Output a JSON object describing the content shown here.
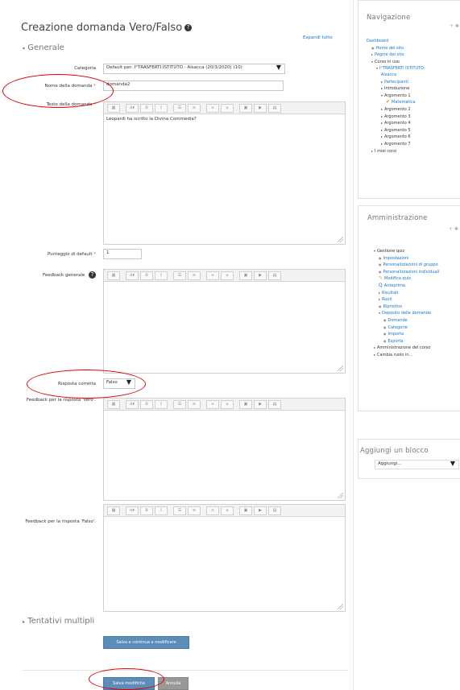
{
  "page_title": "Creazione domanda Vero/Falso",
  "expand_all": "Espandi tutto",
  "section_general": "Generale",
  "section_multiple": "Tentativi multipli",
  "category": {
    "label": "Categoria",
    "value": "Default per: I°TRASFERTI ISTITUTO - Alsacca (20/3/2020) (10)"
  },
  "question_name": {
    "label": "Nome della domanda",
    "value": "domanda2"
  },
  "question_text": {
    "label": "Testo della domanda",
    "value": "Leopardi ha scritto la Divina Commedia?"
  },
  "default_mark": {
    "label": "Punteggio di default",
    "value": "1"
  },
  "general_feedback": {
    "label": "Feedback generale"
  },
  "correct_answer": {
    "label": "Risposta corretta",
    "value": "Falso"
  },
  "feedback_true": {
    "label": "Feedback per la risposta 'Vero'."
  },
  "feedback_false": {
    "label": "Feedback per la risposta 'Falso'."
  },
  "buttons": {
    "save_continue": "Salva e continua a modificare",
    "save": "Salva modifiche",
    "cancel": "Annulla"
  },
  "toolbar_icons": [
    "table-icon",
    "font-size-icon",
    "bold-icon",
    "italic-icon",
    "unordered-list-icon",
    "ordered-list-icon",
    "link-icon",
    "unlink-icon",
    "image-icon",
    "media-icon",
    "file-icon"
  ],
  "navigation": {
    "title": "Navigazione",
    "items": [
      {
        "text": "Dashboard",
        "level": 0,
        "kind": "link"
      },
      {
        "text": "Home del sito",
        "level": 1,
        "kind": "dot"
      },
      {
        "text": "Pagine del sito",
        "level": 1,
        "kind": "tri"
      },
      {
        "text": "Corso in uso",
        "level": 1,
        "kind": "open",
        "plain": true
      },
      {
        "text": "I°TRASFERTI ISTITUTO-",
        "level": 2,
        "kind": "open"
      },
      {
        "text": "Alsacca",
        "level": 3,
        "kind": "none"
      },
      {
        "text": "Partecipanti",
        "level": 3,
        "kind": "tri"
      },
      {
        "text": "Introduzione",
        "level": 3,
        "kind": "tri",
        "plain": true
      },
      {
        "text": "Argomento 1",
        "level": 3,
        "kind": "open",
        "plain": true
      },
      {
        "text": "Matematica",
        "level": 4,
        "kind": "quiz"
      },
      {
        "text": "Argomento 2",
        "level": 3,
        "kind": "tri",
        "plain": true
      },
      {
        "text": "Argomento 3",
        "level": 3,
        "kind": "tri",
        "plain": true
      },
      {
        "text": "Argomento 4",
        "level": 3,
        "kind": "tri",
        "plain": true
      },
      {
        "text": "Argomento 5",
        "level": 3,
        "kind": "tri",
        "plain": true
      },
      {
        "text": "Argomento 6",
        "level": 3,
        "kind": "tri",
        "plain": true
      },
      {
        "text": "Argomento 7",
        "level": 3,
        "kind": "tri",
        "plain": true
      },
      {
        "text": "I miei corsi",
        "level": 1,
        "kind": "tri",
        "plain": true
      }
    ]
  },
  "administration": {
    "title": "Amministrazione",
    "items": [
      {
        "text": "Gestione quiz",
        "level": 1,
        "kind": "open",
        "plain": true
      },
      {
        "text": "Impostazioni",
        "level": 2,
        "kind": "dot"
      },
      {
        "text": "Personalizzazioni di gruppo",
        "level": 2,
        "kind": "dot"
      },
      {
        "text": "Personalizzazioni individuali",
        "level": 2,
        "kind": "dot"
      },
      {
        "text": "Modifica quiz",
        "level": 2,
        "kind": "pencil"
      },
      {
        "text": "Anteprima",
        "level": 2,
        "kind": "search"
      },
      {
        "text": "Risultati",
        "level": 2,
        "kind": "tri"
      },
      {
        "text": "Ruoli",
        "level": 2,
        "kind": "tri"
      },
      {
        "text": "Ripristino",
        "level": 2,
        "kind": "dot"
      },
      {
        "text": "Deposito delle domande",
        "level": 2,
        "kind": "open"
      },
      {
        "text": "Domande",
        "level": 3,
        "kind": "dot"
      },
      {
        "text": "Categorie",
        "level": 3,
        "kind": "dot"
      },
      {
        "text": "Importa",
        "level": 3,
        "kind": "dot"
      },
      {
        "text": "Esporta",
        "level": 3,
        "kind": "dot"
      },
      {
        "text": "Amministrazione del corso",
        "level": 1,
        "kind": "tri",
        "plain": true
      },
      {
        "text": "Cambia ruolo in...",
        "level": 1,
        "kind": "tri",
        "plain": true
      }
    ]
  },
  "add_block": {
    "title": "Aggiungi un blocco",
    "value": "Aggiungi..."
  },
  "colors": {
    "link": "#1177d1",
    "primary_button": "#5b8db8",
    "annotation": "#e00000",
    "required": "#d9534f"
  }
}
